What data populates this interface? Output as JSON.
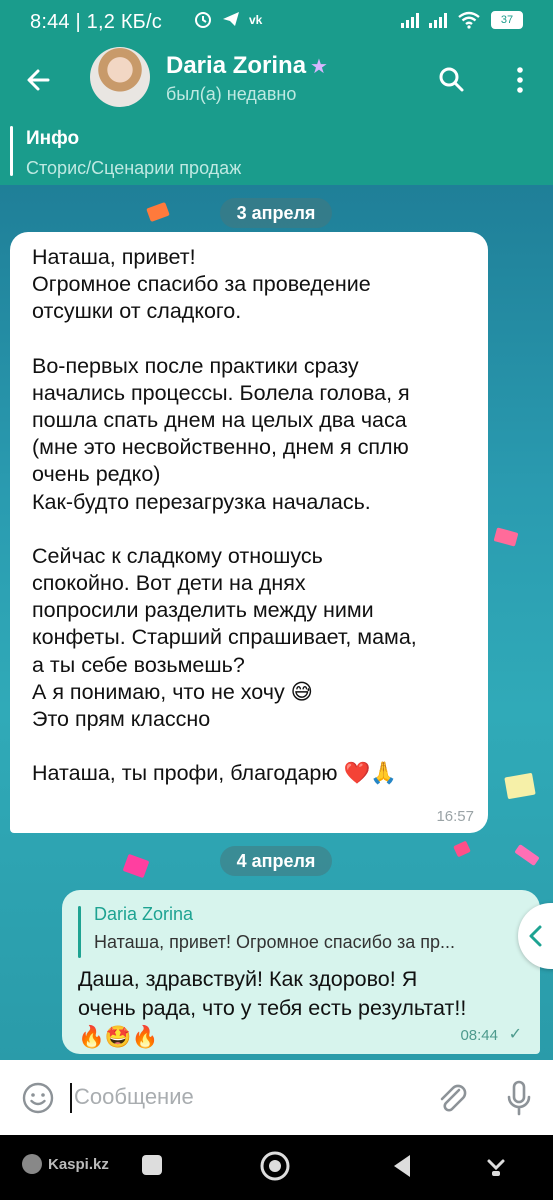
{
  "status_bar": {
    "time": "8:44",
    "speed": "1,2 КБ/с",
    "battery": "37"
  },
  "header": {
    "contact_name": "Daria Zorina",
    "last_seen": "был(а) недавно"
  },
  "pinned": {
    "title": "Инфо",
    "subtitle": "Сторис/Сценарии продаж"
  },
  "chat": {
    "date1": "3 апреля",
    "incoming_message": {
      "paragraphs": [
        [
          "Наташа, привет!",
          "Огромное спасибо за проведение",
          "отсушки от сладкого."
        ],
        [
          "Во-первых после практики сразу",
          "начались процессы. Болела голова, я",
          "пошла спать днем на целых два часа",
          "(мне это несвойственно, днем я сплю",
          "очень редко)",
          "Как-будто перезагрузка началась."
        ],
        [
          "Сейчас к сладкому отношусь",
          "спокойно. Вот дети на днях",
          "попросили разделить между ними",
          "конфеты. Старший спрашивает, мама,",
          "а ты себе возьмешь?",
          "А я понимаю, что не хочу 😅",
          "Это прям классно"
        ],
        [
          "Наташа, ты профи, благодарю ❤️🙏"
        ]
      ],
      "time": "16:57"
    },
    "date2": "4 апреля",
    "outgoing_message": {
      "reply_name": "Daria Zorina",
      "reply_text": "Наташа, привет! Огромное спасибо за пр...",
      "line1": "Даша, здравствуй! Как здорово! Я",
      "line2": "очень рада, что у тебя есть результат!!",
      "line3": "🔥🤩🔥",
      "time": "08:44"
    }
  },
  "input": {
    "placeholder": "Сообщение"
  },
  "navbar": {
    "kaspi_label": "Kaspi.kz"
  },
  "colors": {
    "header": "#1a9c8c",
    "outgoing_bubble": "#d7f4ed",
    "accent": "#1ea392"
  }
}
